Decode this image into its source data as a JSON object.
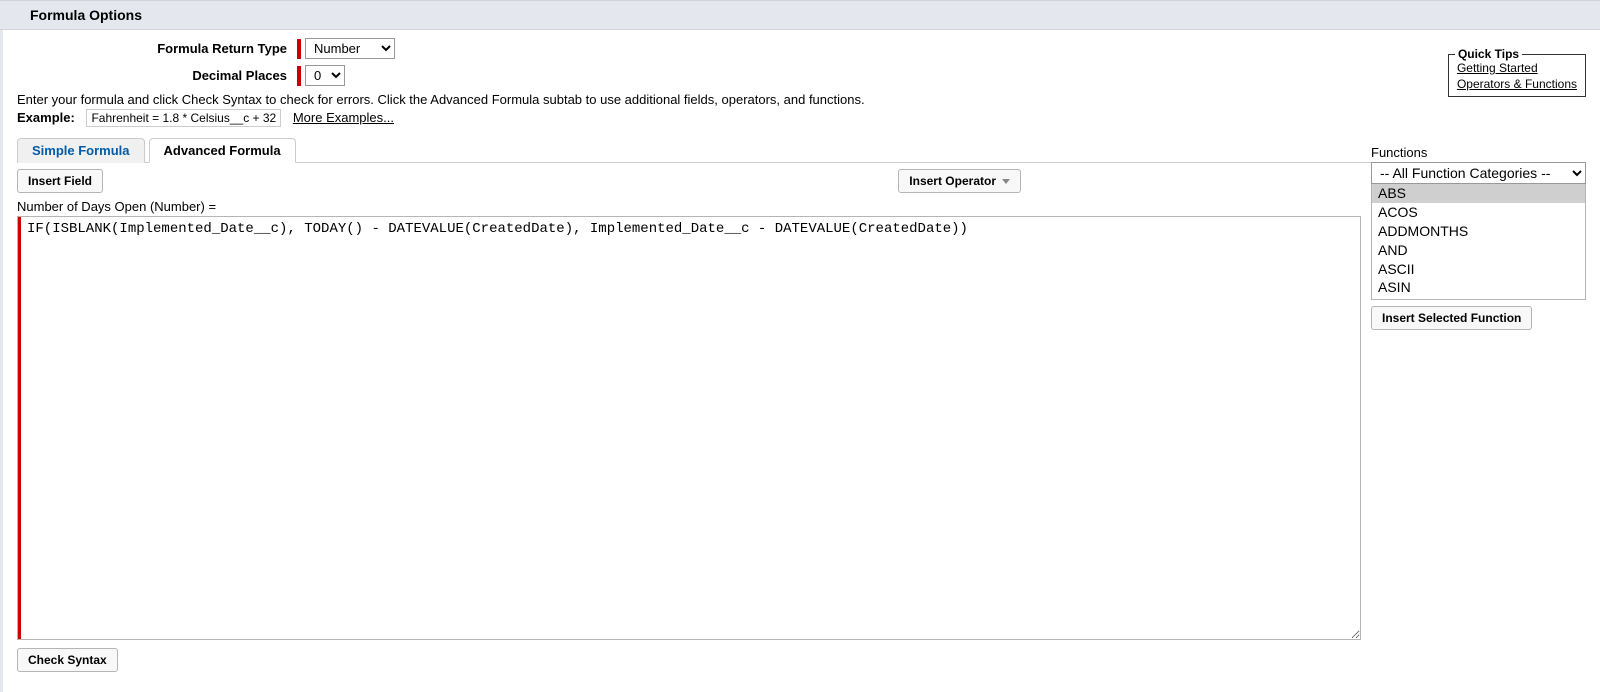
{
  "header": {
    "title": "Formula Options"
  },
  "form": {
    "return_type_label": "Formula Return Type",
    "return_type_value": "Number",
    "decimal_label": "Decimal Places",
    "decimal_value": "0"
  },
  "instruction": "Enter your formula and click Check Syntax to check for errors. Click the Advanced Formula subtab to use additional fields, operators, and functions.",
  "example": {
    "label": "Example:",
    "text": "Fahrenheit = 1.8 * Celsius__c + 32",
    "more_link": "More Examples..."
  },
  "quick_tips": {
    "legend": "Quick Tips",
    "links": [
      "Getting Started",
      "Operators & Functions"
    ]
  },
  "tabs": {
    "simple": "Simple Formula",
    "advanced": "Advanced Formula",
    "active": "advanced"
  },
  "toolbar": {
    "insert_field": "Insert Field",
    "insert_operator": "Insert Operator"
  },
  "field": {
    "label": "Number of Days Open (Number) =",
    "formula": "IF(ISBLANK(Implemented_Date__c), TODAY() - DATEVALUE(CreatedDate), Implemented_Date__c - DATEVALUE(CreatedDate))"
  },
  "functions": {
    "label": "Functions",
    "category": "-- All Function Categories --",
    "list": [
      "ABS",
      "ACOS",
      "ADDMONTHS",
      "AND",
      "ASCII",
      "ASIN"
    ],
    "selected": "ABS",
    "insert_btn": "Insert Selected Function"
  },
  "footer": {
    "check_syntax": "Check Syntax"
  }
}
